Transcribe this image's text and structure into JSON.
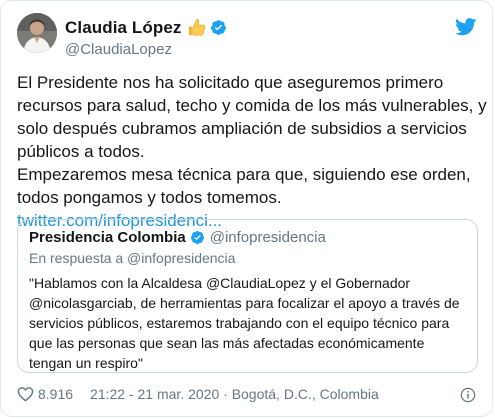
{
  "author": {
    "name": "Claudia López",
    "handle": "@ClaudiaLopez",
    "thumbs_emoji": "👍"
  },
  "tweet": {
    "text": "El Presidente nos ha solicitado que aseguremos primero\nrecursos para salud, techo y comida de los más vulnerables, y\nsolo después cubramos ampliación de subsidios a servicios\npúblicos a todos.\nEmpezaremos mesa técnica para que, siguiendo ese orden,\ntodos pongamos y todos tomemos. ",
    "link": "twitter.com/infopresidenci..."
  },
  "quoted": {
    "name": "Presidencia Colombia",
    "handle": "@infopresidencia",
    "reply_context": "En respuesta a @infopresidencia",
    "text": "\"Hablamos con la Alcaldesa @ClaudiaLopez y el Gobernador\n@nicolasgarciab, de herramientas para focalizar el apoyo a través de\nservicios públicos, estaremos trabajando con el equipo técnico para\nque las personas que sean las más afectadas económicamente\ntengan un respiro\""
  },
  "footer": {
    "likes": "8.916",
    "meta": "21:22 - 21 mar. 2020 · Bogotá, D.C., Colombia"
  },
  "colors": {
    "verified": "#1da1f2",
    "link": "#1b95e0",
    "muted": "#657786",
    "border": "#e1e8ed"
  }
}
